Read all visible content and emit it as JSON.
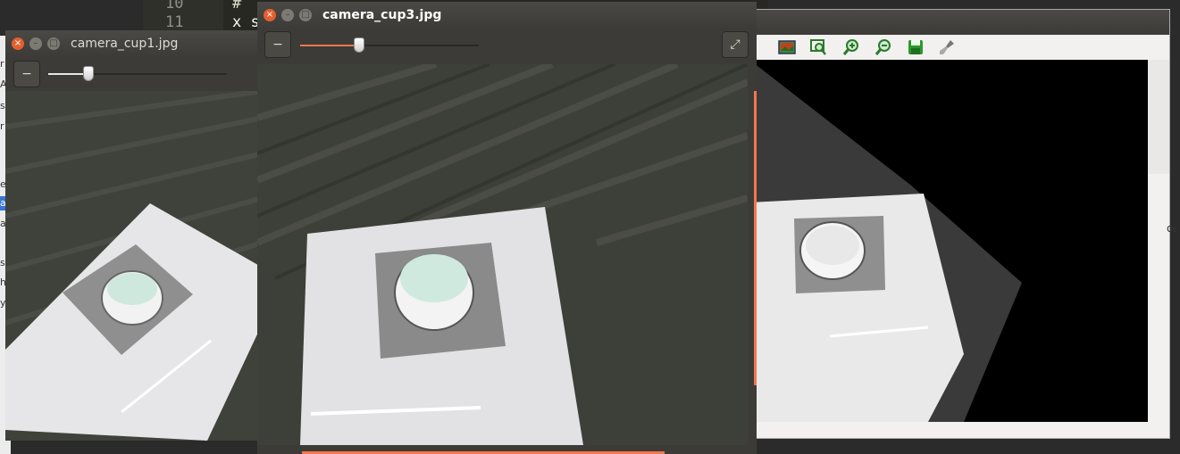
{
  "editor": {
    "line_numbers": [
      "10",
      "11"
    ],
    "code_fragments": [
      "#",
      "x s"
    ]
  },
  "left_strip": {
    "fragments": [
      "r",
      "A",
      "s",
      "r",
      "e",
      "a",
      "a",
      "s",
      "h",
      "y"
    ]
  },
  "win_back": {
    "side_text": "oi",
    "toolbar_icons": [
      "picture-icon",
      "zoom-fit-icon",
      "zoom-in-icon",
      "zoom-out-icon",
      "save-icon",
      "clear-icon"
    ]
  },
  "win_cup1": {
    "title": "camera_cup1.jpg",
    "collapse_label": "−",
    "slider_value_fraction": 0.22
  },
  "win_cup3": {
    "title": "camera_cup3.jpg",
    "collapse_label": "−",
    "fullscreen_label": "⤢",
    "slider_value_fraction": 0.33
  },
  "titlebar": {
    "close_glyph": "×",
    "min_glyph": "–",
    "max_glyph": "□"
  },
  "colors": {
    "accent": "#e2602f",
    "chrome": "#3c3b37",
    "slider_fill": "#f0794a"
  }
}
